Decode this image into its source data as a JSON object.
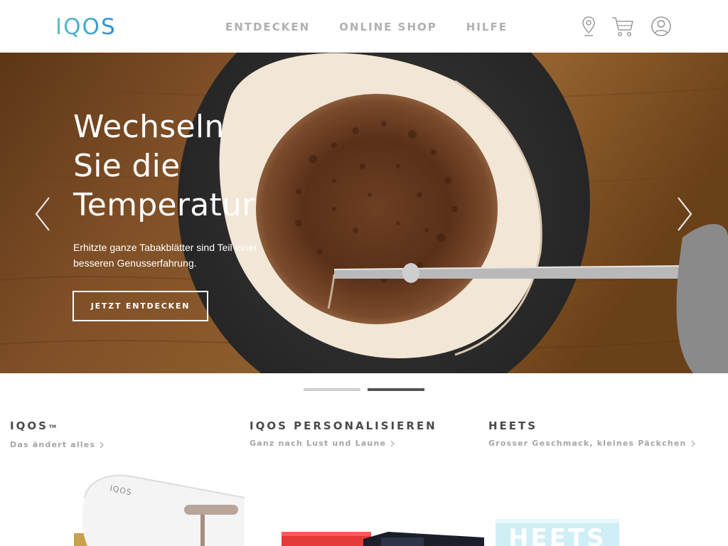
{
  "header": {
    "logo_text": "IQOS",
    "nav": [
      "ENTDECKEN",
      "ONLINE SHOP",
      "HILFE"
    ],
    "icons": [
      "location-pin-icon",
      "shopping-cart-icon",
      "user-account-icon"
    ]
  },
  "hero": {
    "title_lines": [
      "Wechseln",
      "Sie die",
      "Temperatur"
    ],
    "description": "Erhitzte ganze Tabakblätter sind Teil einer besseren Genusserfahrung.",
    "cta_label": "JETZT ENTDECKEN",
    "slides": 2,
    "active_slide": 2
  },
  "tiles": [
    {
      "title": "IQOS",
      "trademark": "TM",
      "subtitle": "Das ändert alles"
    },
    {
      "title": "IQOS PERSONALISIEREN",
      "subtitle": "Ganz nach Lust und Laune"
    },
    {
      "title": "HEETS",
      "subtitle": "Grosser Geschmack, kleines Päckchen",
      "product_text": "HEETS"
    }
  ],
  "colors": {
    "nav_text": "#b0b0b0",
    "logo_gradient": [
      "#5bb8c9",
      "#2a9bd6"
    ],
    "tile_title": "#4a4a4a",
    "tile_subtitle": "#a5a5a5",
    "active_dot": "#545454",
    "inactive_dot": "#cfcfcf"
  }
}
